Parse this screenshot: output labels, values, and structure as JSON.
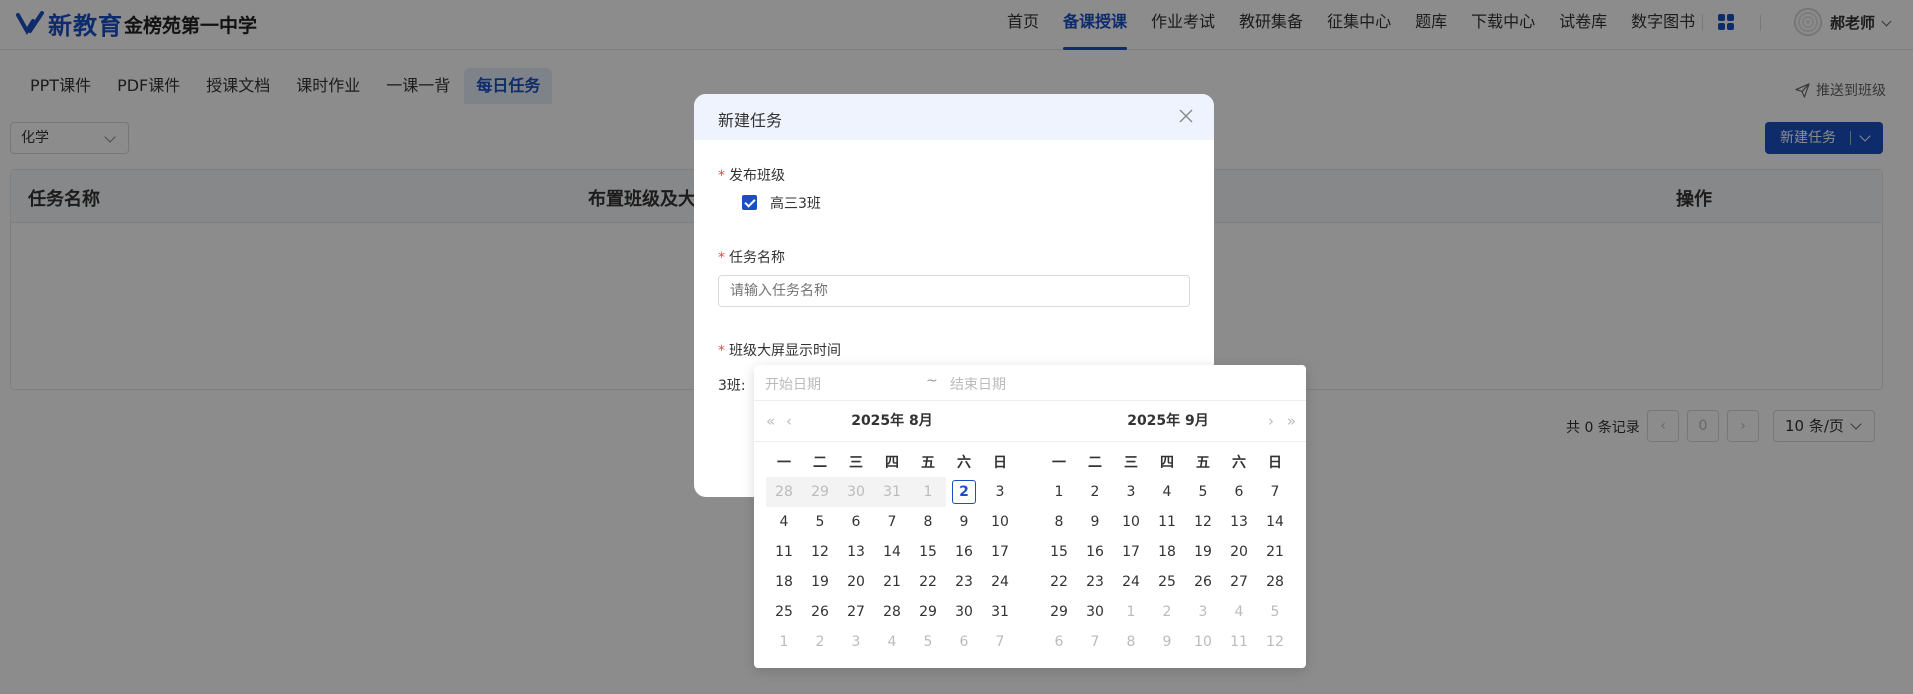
{
  "header": {
    "logo_text": "新教育",
    "school_name": "金榜苑第一中学",
    "nav": [
      "首页",
      "备课授课",
      "作业考试",
      "教研集备",
      "征集中心",
      "题库",
      "下载中心",
      "试卷库",
      "数字图书"
    ],
    "active_nav": "备课授课",
    "username": "郝老师"
  },
  "tabs": [
    "PPT课件",
    "PDF课件",
    "授课文档",
    "课时作业",
    "一课一背",
    "每日任务"
  ],
  "active_tab": "每日任务",
  "push_label": "推送到班级",
  "subject": "化学",
  "new_task_label": "新建任务",
  "table": {
    "columns": [
      "任务名称",
      "布置班级及大",
      "操作"
    ]
  },
  "pager": {
    "total": "共 0 条记录",
    "page": "0",
    "page_size": "10 条/页"
  },
  "modal": {
    "title": "新建任务",
    "class_label": "发布班级",
    "class_option": "高三3班",
    "name_label": "任务名称",
    "name_placeholder": "请输入任务名称",
    "display_label": "班级大屏显示时间",
    "row_label": "3班:"
  },
  "datepicker": {
    "start_placeholder": "开始日期",
    "separator": "~",
    "end_placeholder": "结束日期",
    "left_title": "2025年 8月",
    "right_title": "2025年 9月",
    "weekdays": [
      "一",
      "二",
      "三",
      "四",
      "五",
      "六",
      "日"
    ],
    "left_weeks": [
      [
        "28",
        "29",
        "30",
        "31",
        "1",
        "2",
        "3"
      ],
      [
        "4",
        "5",
        "6",
        "7",
        "8",
        "9",
        "10"
      ],
      [
        "11",
        "12",
        "13",
        "14",
        "15",
        "16",
        "17"
      ],
      [
        "18",
        "19",
        "20",
        "21",
        "22",
        "23",
        "24"
      ],
      [
        "25",
        "26",
        "27",
        "28",
        "29",
        "30",
        "31"
      ],
      [
        "1",
        "2",
        "3",
        "4",
        "5",
        "6",
        "7"
      ]
    ],
    "right_weeks": [
      [
        "1",
        "2",
        "3",
        "4",
        "5",
        "6",
        "7"
      ],
      [
        "8",
        "9",
        "10",
        "11",
        "12",
        "13",
        "14"
      ],
      [
        "15",
        "16",
        "17",
        "18",
        "19",
        "20",
        "21"
      ],
      [
        "22",
        "23",
        "24",
        "25",
        "26",
        "27",
        "28"
      ],
      [
        "29",
        "30",
        "1",
        "2",
        "3",
        "4",
        "5"
      ],
      [
        "6",
        "7",
        "8",
        "9",
        "10",
        "11",
        "12"
      ]
    ],
    "today": "2"
  },
  "colors": {
    "accent": "#1a4fc4",
    "required": "#e34d4d"
  }
}
